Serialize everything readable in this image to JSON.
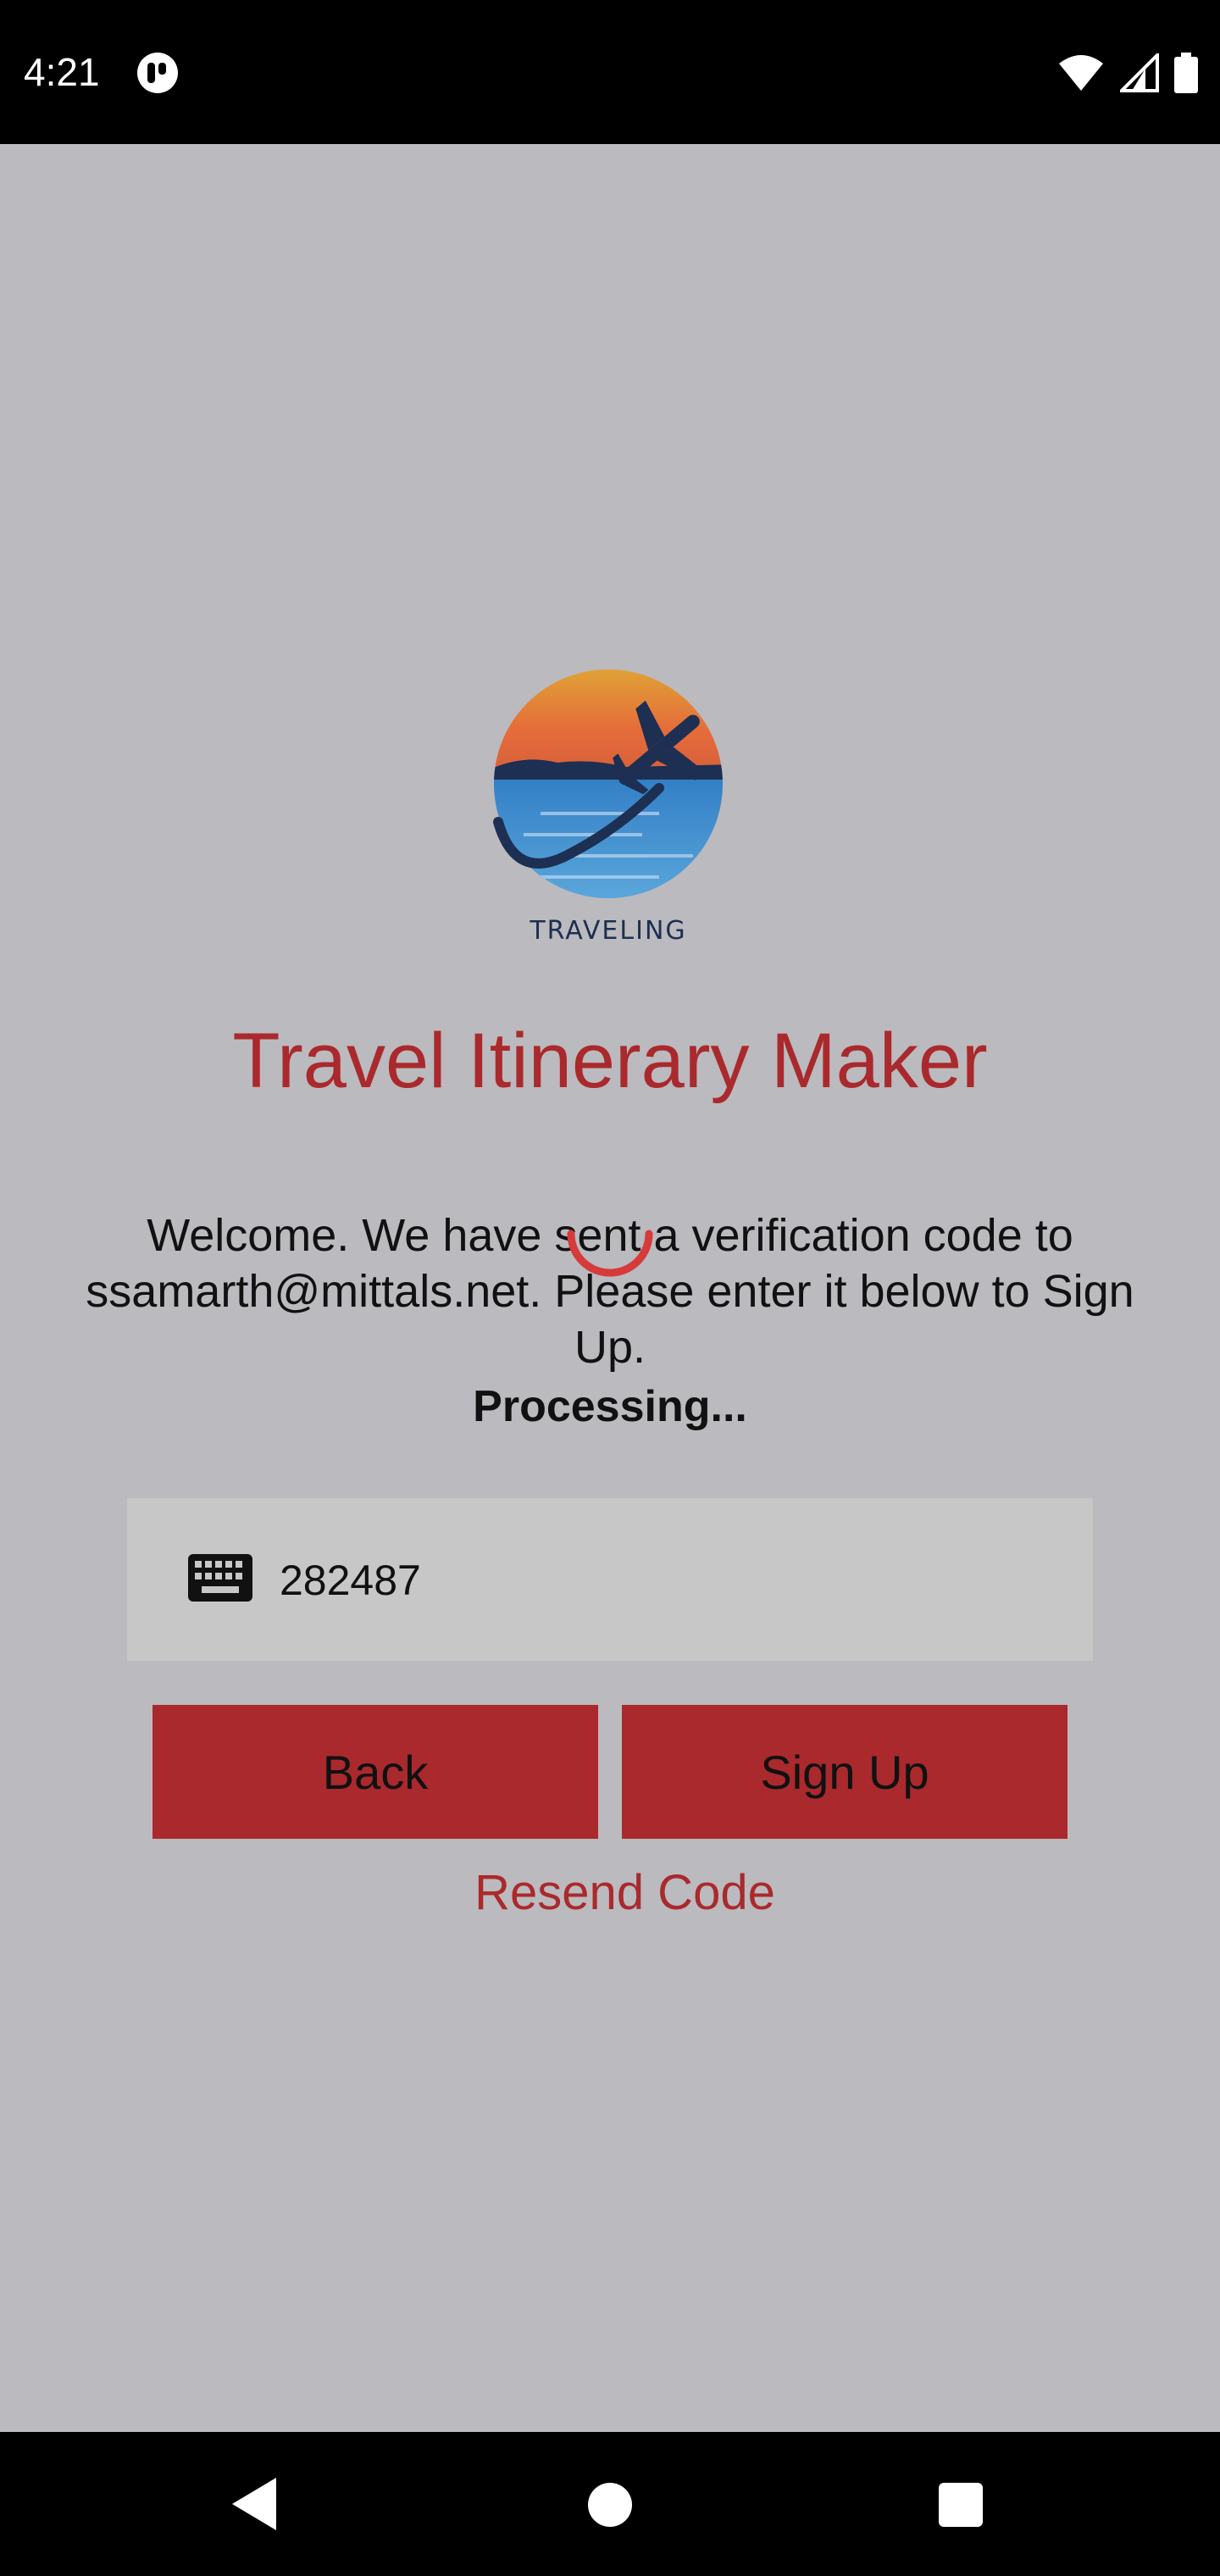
{
  "status_bar": {
    "time": "4:21",
    "icons": [
      "app-notification-icon",
      "wifi-icon",
      "cell-signal-icon",
      "battery-icon"
    ]
  },
  "app": {
    "title": "Travel Itinerary Maker",
    "logo_text": "TRAVELING",
    "message": "Welcome. We have sent a verification code to ssamarth@mittals.net. Please enter it below to Sign Up.",
    "status": "Processing...",
    "code_field": {
      "value": "282487",
      "icon": "keyboard-icon"
    },
    "buttons": {
      "back": "Back",
      "sign_up": "Sign Up"
    },
    "resend_link": "Resend Code"
  },
  "colors": {
    "accent": "#aa292c",
    "overlay_background": "#bbbabe",
    "system_bars": "#000000"
  },
  "nav_bar": {
    "icons": [
      "back-triangle-icon",
      "home-circle-icon",
      "recents-square-icon"
    ]
  }
}
